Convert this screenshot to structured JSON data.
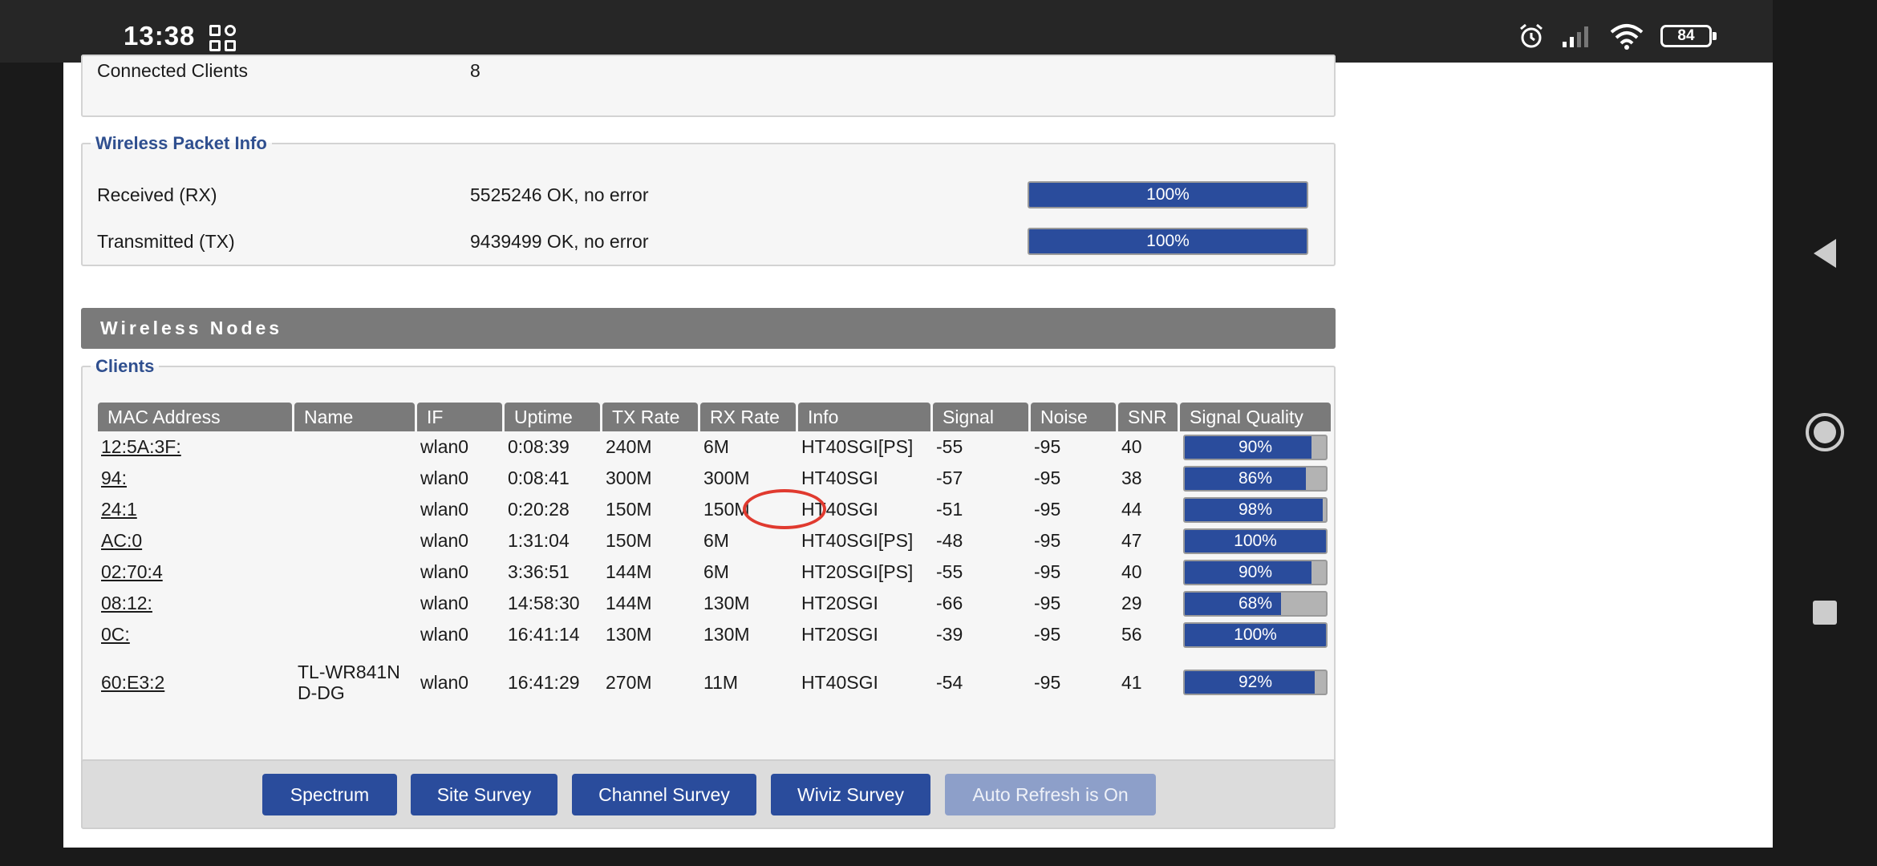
{
  "status_bar": {
    "time": "13:38",
    "battery": "84",
    "icons": [
      "app-grid-icon",
      "alarm-icon",
      "signal-icon",
      "wifi-icon",
      "battery-icon"
    ]
  },
  "top_section": {
    "connected_clients_label": "Connected Clients",
    "connected_clients_value": "8"
  },
  "packet_info": {
    "legend": "Wireless Packet Info",
    "rx_label": "Received (RX)",
    "rx_value": "5525246 OK, no error",
    "rx_percent": "100%",
    "tx_label": "Transmitted (TX)",
    "tx_value": "9439499 OK, no error",
    "tx_percent": "100%"
  },
  "nodes": {
    "header": "Wireless Nodes",
    "clients_legend": "Clients",
    "columns": [
      "MAC Address",
      "Name",
      "IF",
      "Uptime",
      "TX Rate",
      "RX Rate",
      "Info",
      "Signal",
      "Noise",
      "SNR",
      "Signal Quality"
    ],
    "rows": [
      {
        "mac": "12:5A:3F:",
        "name": "",
        "if": "wlan0",
        "uptime": "0:08:39",
        "tx": "240M",
        "rx": "6M",
        "info": "HT40SGI[PS]",
        "signal": "-55",
        "noise": "-95",
        "snr": "40",
        "quality": "90%",
        "quality_value": 90
      },
      {
        "mac": "94:",
        "name": "",
        "if": "wlan0",
        "uptime": "0:08:41",
        "tx": "300M",
        "rx": "300M",
        "info": "HT40SGI",
        "signal": "-57",
        "noise": "-95",
        "snr": "38",
        "quality": "86%",
        "quality_value": 86
      },
      {
        "mac": "24:1",
        "name": "",
        "if": "wlan0",
        "uptime": "0:20:28",
        "tx": "150M",
        "rx": "150M",
        "info": "HT40SGI",
        "signal": "-51",
        "noise": "-95",
        "snr": "44",
        "quality": "98%",
        "quality_value": 98
      },
      {
        "mac": "AC:0",
        "name": "",
        "if": "wlan0",
        "uptime": "1:31:04",
        "tx": "150M",
        "rx": "6M",
        "info": "HT40SGI[PS]",
        "signal": "-48",
        "noise": "-95",
        "snr": "47",
        "quality": "100%",
        "quality_value": 100
      },
      {
        "mac": "02:70:4",
        "name": "",
        "if": "wlan0",
        "uptime": "3:36:51",
        "tx": "144M",
        "rx": "6M",
        "info": "HT20SGI[PS]",
        "signal": "-55",
        "noise": "-95",
        "snr": "40",
        "quality": "90%",
        "quality_value": 90
      },
      {
        "mac": "08:12:",
        "name": "",
        "if": "wlan0",
        "uptime": "14:58:30",
        "tx": "144M",
        "rx": "130M",
        "info": "HT20SGI",
        "signal": "-66",
        "noise": "-95",
        "snr": "29",
        "quality": "68%",
        "quality_value": 68
      },
      {
        "mac": "0C:",
        "name": "",
        "if": "wlan0",
        "uptime": "16:41:14",
        "tx": "130M",
        "rx": "130M",
        "info": "HT20SGI",
        "signal": "-39",
        "noise": "-95",
        "snr": "56",
        "quality": "100%",
        "quality_value": 100
      },
      {
        "mac": "60:E3:2",
        "name": "TL-WR841ND-DG",
        "if": "wlan0",
        "uptime": "16:41:29",
        "tx": "270M",
        "rx": "11M",
        "info": "HT40SGI",
        "signal": "-54",
        "noise": "-95",
        "snr": "41",
        "quality": "92%",
        "quality_value": 92
      }
    ]
  },
  "buttons": {
    "spectrum": "Spectrum",
    "site_survey": "Site Survey",
    "channel_survey": "Channel Survey",
    "wiviz_survey": "Wiviz Survey",
    "auto_refresh": "Auto Refresh is On"
  },
  "colors": {
    "accent": "#2a4c9c",
    "header_gray": "#7a7a7a",
    "annotation": "#e03a2f"
  }
}
